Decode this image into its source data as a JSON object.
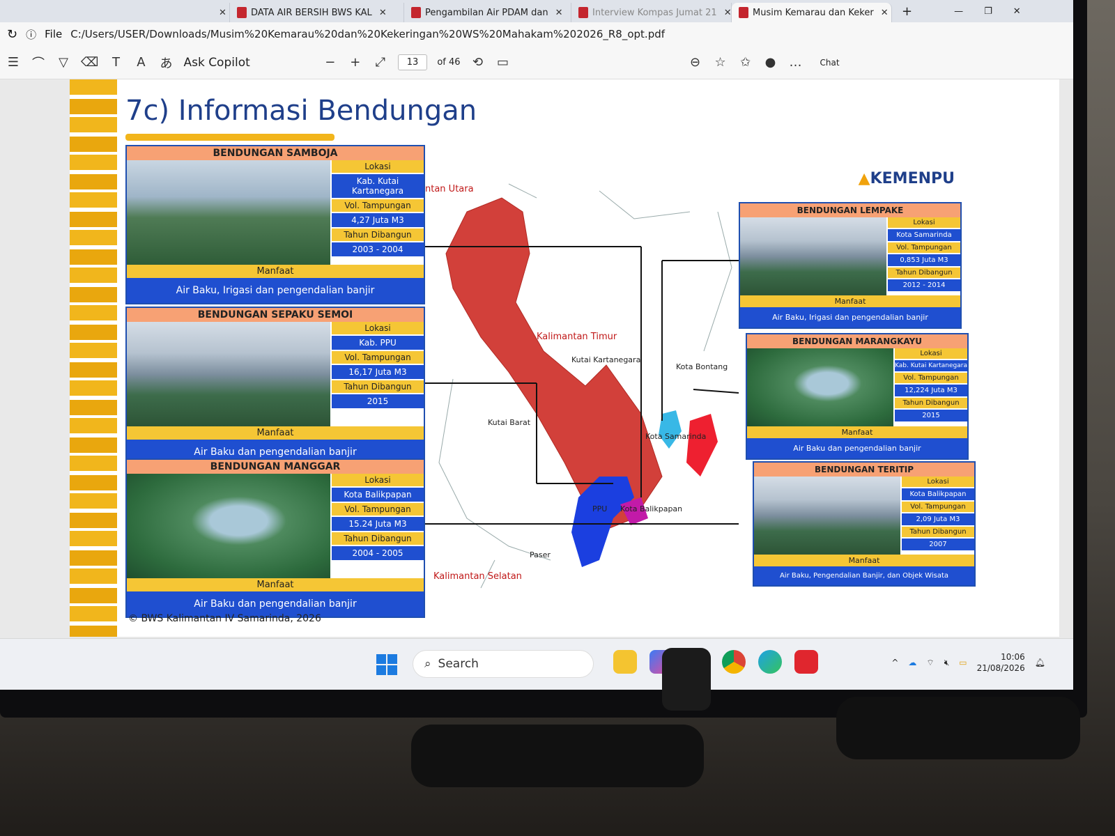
{
  "browser": {
    "tabs": [
      {
        "label": "DATA AIR BERSIH BWS KAL"
      },
      {
        "label": "Pengambilan Air PDAM dan"
      },
      {
        "label": "Interview Kompas Jumat 21"
      },
      {
        "label": "Musim Kemarau dan Keker",
        "active": true
      }
    ],
    "address_prefix": "File",
    "url": "C:/Users/USER/Downloads/Musim%20Kemarau%20dan%20Kekeringan%20WS%20Mahakam%202026_R8_opt.pdf"
  },
  "pdf_toolbar": {
    "ask_copilot": "Ask Copilot",
    "page_current": "13",
    "page_total": "of 46",
    "chat": "Chat"
  },
  "slide": {
    "title": "7c) Informasi Bendungan",
    "logo": "KEMENPU",
    "copyright": "© BWS Kalimantan IV Samarinda, 2026",
    "labels": {
      "lokasi": "Lokasi",
      "vol": "Vol. Tampungan",
      "tahun": "Tahun Dibangun",
      "manfaat": "Manfaat"
    },
    "dams": [
      {
        "name": "BENDUNGAN SAMBOJA",
        "lokasi": "Kab. Kutai Kartanegara",
        "vol": "4,27 Juta M3",
        "tahun": "2003 - 2004",
        "manfaat": "Air Baku, Irigasi dan pengendalian banjir"
      },
      {
        "name": "BENDUNGAN SEPAKU SEMOI",
        "lokasi": "Kab. PPU",
        "vol": "16,17 Juta M3",
        "tahun": "2015",
        "manfaat": "Air Baku dan pengendalian banjir"
      },
      {
        "name": "BENDUNGAN MANGGAR",
        "lokasi": "Kota Balikpapan",
        "vol": "15.24 Juta M3",
        "tahun": "2004 - 2005",
        "manfaat": "Air Baku dan pengendalian banjir"
      },
      {
        "name": "BENDUNGAN LEMPAKE",
        "lokasi": "Kota Samarinda",
        "vol": "0,853 Juta M3",
        "tahun": "2012 - 2014",
        "manfaat": "Air Baku, Irigasi dan pengendalian banjir"
      },
      {
        "name": "BENDUNGAN MARANGKAYU",
        "lokasi": "Kab. Kutai Kartanegara",
        "vol": "12,224 Juta M3",
        "tahun": "2015",
        "manfaat": "Air Baku dan pengendalian banjir"
      },
      {
        "name": "BENDUNGAN TERITIP",
        "lokasi": "Kota Balikpapan",
        "vol": "2,09 Juta M3",
        "tahun": "2007",
        "manfaat": "Air Baku, Pengendalian Banjir, dan Objek Wisata"
      }
    ],
    "map_labels": {
      "utara": "ntan Utara",
      "timur": "Kalimantan Timur",
      "kukar": "Kutai Kartanegara",
      "bontang": "Kota Bontang",
      "kubar": "Kutai Barat",
      "samarinda": "Kota Samarinda",
      "ppu": "PPU",
      "balikpapan": "Kota Balikpapan",
      "paser": "Paser",
      "selatan": "Kalimantan Selatan"
    }
  },
  "taskbar": {
    "search_placeholder": "Search",
    "time": "10:06",
    "date": "21/08/2026"
  }
}
